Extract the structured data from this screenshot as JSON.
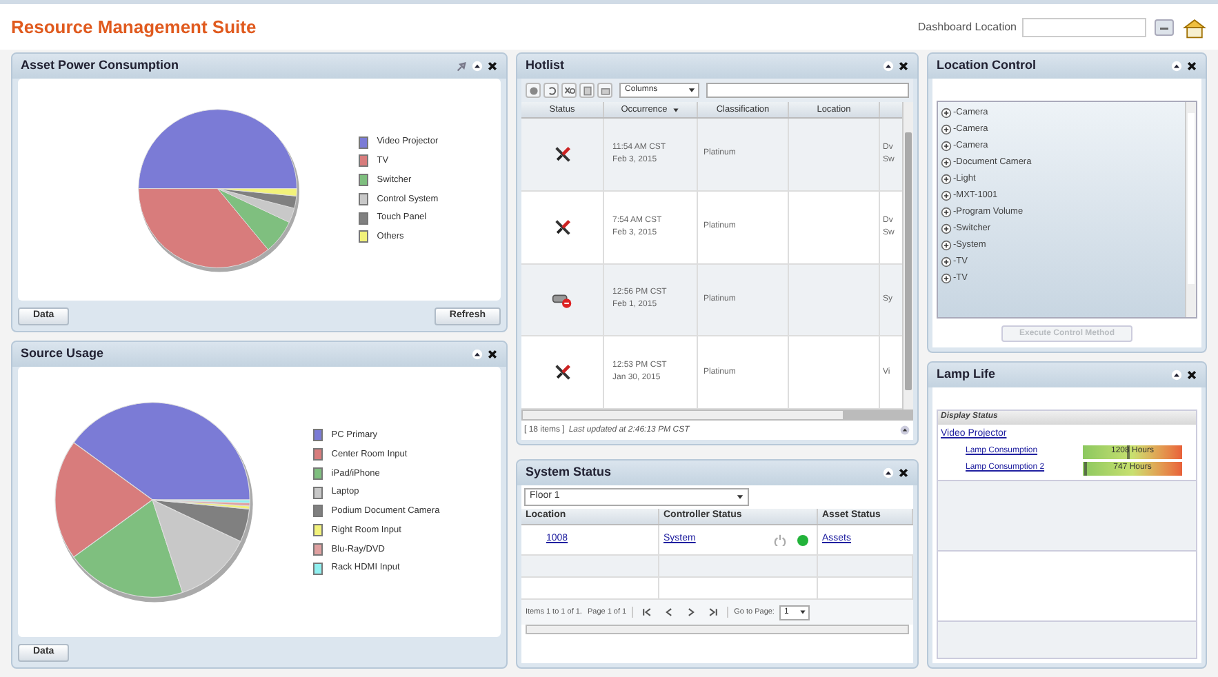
{
  "app": {
    "title": "Resource Management Suite",
    "location_label": "Dashboard Location"
  },
  "asset_power": {
    "title": "Asset Power Consumption",
    "legend": [
      {
        "label": "Video Projector",
        "color": "#7b7bd6"
      },
      {
        "label": "TV",
        "color": "#d87c7c"
      },
      {
        "label": "Switcher",
        "color": "#7fbf7f"
      },
      {
        "label": "Control System",
        "color": "#c8c8c8"
      },
      {
        "label": "Touch Panel",
        "color": "#808080"
      },
      {
        "label": "Others",
        "color": "#f2f27a"
      }
    ],
    "buttons": [
      "Data",
      "Refresh"
    ]
  },
  "source_usage": {
    "title": "Source Usage",
    "legend": [
      {
        "label": "PC Primary",
        "color": "#7b7bd6"
      },
      {
        "label": "Center Room Input",
        "color": "#d87c7c"
      },
      {
        "label": "iPad/iPhone",
        "color": "#7fbf7f"
      },
      {
        "label": "Laptop",
        "color": "#c8c8c8"
      },
      {
        "label": "Podium Document Camera",
        "color": "#808080"
      },
      {
        "label": "Right Room Input",
        "color": "#f2f27a"
      },
      {
        "label": "Blu-Ray/DVD",
        "color": "#e0a0a0"
      },
      {
        "label": "Rack HDMI Input",
        "color": "#8ff0f0"
      }
    ],
    "buttons": [
      "Data"
    ]
  },
  "hotlist": {
    "title": "Hotlist",
    "columns_select": "Columns",
    "columns": [
      "Status",
      "Occurrence",
      "Classification",
      "Location"
    ],
    "rows": [
      {
        "kind": "tool",
        "time": "11:54 AM CST",
        "date": "Feb 3, 2015",
        "classification": "Platinum",
        "location": "",
        "column_5": [
          "Dv",
          "Sw"
        ]
      },
      {
        "kind": "tool",
        "time": "7:54 AM CST",
        "date": "Feb 3, 2015",
        "classification": "Platinum",
        "location": "",
        "column_5": [
          "Dv",
          "Sw"
        ]
      },
      {
        "kind": "cable",
        "time": "12:56 PM CST",
        "date": "Feb 1, 2015",
        "classification": "Platinum",
        "location": "",
        "column_5": [
          "Sy"
        ]
      },
      {
        "kind": "tool",
        "time": "12:53 PM CST",
        "date": "Jan 30, 2015",
        "classification": "Platinum",
        "location": "",
        "column_5": [
          "Vi"
        ]
      }
    ],
    "footer": "[ 18 items ]",
    "updated": "Last updated at 2:46:13 PM CST"
  },
  "system_status": {
    "title": "System Status",
    "floor": "Floor 1",
    "columns": [
      "Location",
      "Controller Status",
      "Asset Status"
    ],
    "rows": [
      {
        "location": "1008",
        "controller": "System",
        "online": true,
        "asset": "Assets"
      }
    ],
    "pager": {
      "items": "Items 1 to 1 of 1.",
      "page": "Page 1 of 1",
      "goto": "Go to Page:",
      "page_value": "1"
    }
  },
  "location_control": {
    "title": "Location Control",
    "items": [
      {
        "label": "-Camera",
        "expanded": false
      },
      {
        "label": "-Camera",
        "expanded": false
      },
      {
        "label": "-Camera",
        "expanded": false
      },
      {
        "label": "-Document Camera",
        "expanded": false
      },
      {
        "label": "-Light",
        "expanded": false
      },
      {
        "label": "-MXT-1001",
        "expanded": false
      },
      {
        "label": "-Program Volume",
        "expanded": false
      },
      {
        "label": "-Switcher",
        "expanded": false
      },
      {
        "label": "-System",
        "expanded": false
      },
      {
        "label": "-TV",
        "expanded": false
      },
      {
        "label": "-TV",
        "expanded": false
      }
    ],
    "button": "Execute Control Method",
    "button_disabled": true
  },
  "lamp_life": {
    "title": "Lamp Life",
    "section": "Display Status",
    "device": "Video Projector",
    "lamps": [
      {
        "label": "Lamp Consumption",
        "reading": "1208 Hours",
        "level": 0.45
      },
      {
        "label": "Lamp Consumption 2",
        "reading": "747 Hours",
        "level": 0.02
      }
    ]
  }
}
